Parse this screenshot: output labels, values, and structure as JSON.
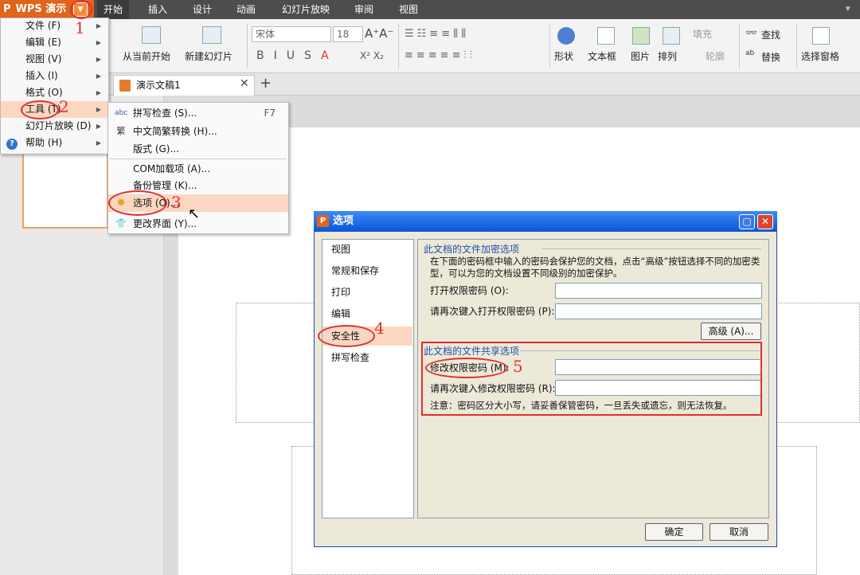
{
  "app": {
    "name": "WPS 演示",
    "logo": "P"
  },
  "tabs": [
    {
      "label": "开始"
    },
    {
      "label": "插入"
    },
    {
      "label": "设计"
    },
    {
      "label": "动画"
    },
    {
      "label": "幻灯片放映"
    },
    {
      "label": "审阅"
    },
    {
      "label": "视图"
    }
  ],
  "ribbon": {
    "from_current": "从当前开始",
    "new_slide": "新建幻灯片",
    "font_name": "宋体",
    "font_size": "18",
    "shape": "形状",
    "textbox": "文本框",
    "picture": "图片",
    "arrange": "排列",
    "fill": "填充",
    "outline": "轮廓",
    "find": "查找",
    "replace": "替换",
    "select_pane": "选择窗格"
  },
  "doc_tab": {
    "title": "演示文稿1"
  },
  "main_menu": [
    {
      "label": "文件 (F)"
    },
    {
      "label": "编辑 (E)"
    },
    {
      "label": "视图 (V)"
    },
    {
      "label": "插入 (I)"
    },
    {
      "label": "格式 (O)"
    },
    {
      "label": "工具 (T)"
    },
    {
      "label": "幻灯片放映 (D)"
    },
    {
      "label": "帮助 (H)"
    }
  ],
  "tools_menu": [
    {
      "label": "拼写检查 (S)...",
      "shortcut": "F7"
    },
    {
      "label": "中文简繁转换 (H)..."
    },
    {
      "label": "版式 (G)..."
    },
    {
      "label": "COM加载项 (A)..."
    },
    {
      "label": "备份管理 (K)..."
    },
    {
      "label": "选项 (O)..."
    },
    {
      "label": "更改界面 (Y)..."
    }
  ],
  "dialog": {
    "title": "选项",
    "nav": [
      "视图",
      "常规和保存",
      "打印",
      "编辑",
      "安全性",
      "拼写检查"
    ],
    "encrypt_section": "此文档的文件加密选项",
    "encrypt_desc": "在下面的密码框中输入的密码会保护您的文档，点击“高级”按钮选择不同的加密类型，可以为您的文档设置不同级别的加密保护。",
    "open_pwd": "打开权限密码 (O):",
    "open_pwd_confirm": "请再次键入打开权限密码 (P):",
    "advanced": "高级 (A)...",
    "share_section": "此文档的文件共享选项",
    "modify_pwd": "修改权限密码 (M):",
    "modify_pwd_confirm": "请再次键入修改权限密码 (R):",
    "note": "注意：密码区分大小写，请妥善保管密码，一旦丢失或遗忘，则无法恢复。",
    "ok": "确定",
    "cancel": "取消"
  },
  "annotations": [
    "1",
    "2",
    "3",
    "4",
    "5"
  ],
  "colors": {
    "accent": "#e0641a",
    "highlight": "#fbd7c2",
    "annotation": "#e03030",
    "titlebar": "#0a55d8"
  }
}
